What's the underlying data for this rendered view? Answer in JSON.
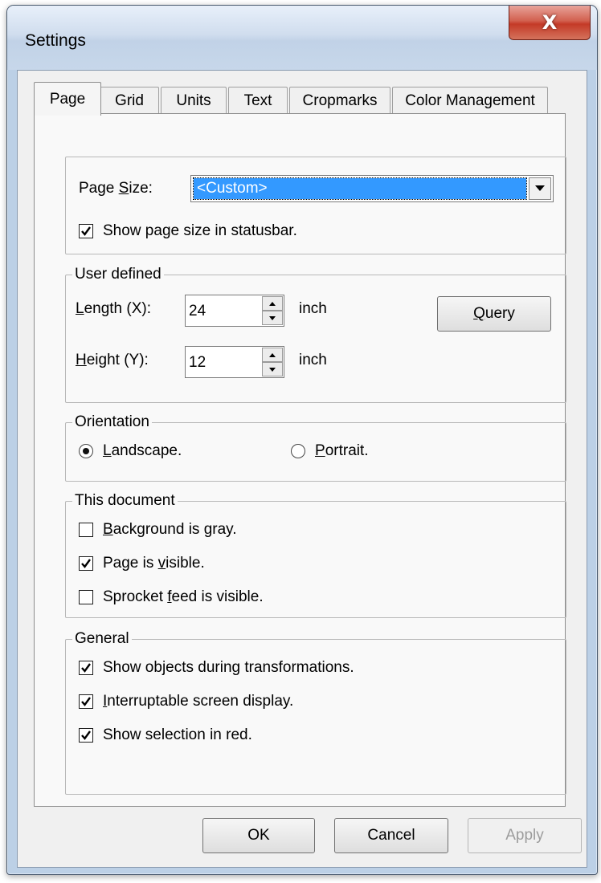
{
  "window": {
    "title": "Settings",
    "close_glyph": "X"
  },
  "tabs": [
    {
      "label": "Page"
    },
    {
      "label": "Grid"
    },
    {
      "label": "Units"
    },
    {
      "label": "Text"
    },
    {
      "label": "Cropmarks"
    },
    {
      "label": "Color Management"
    }
  ],
  "page_size": {
    "label": "Page Size:",
    "value": "<Custom>",
    "show_in_statusbar": {
      "label": "Show page size in statusbar.",
      "checked": true
    }
  },
  "user_defined": {
    "title": "User defined",
    "length": {
      "label": "Length  (X):",
      "value": "24",
      "unit": "inch"
    },
    "height": {
      "label": "Height (Y):",
      "value": "12",
      "unit": "inch"
    },
    "query_button": "Query"
  },
  "orientation": {
    "title": "Orientation",
    "landscape": {
      "label": "Landscape.",
      "selected": true
    },
    "portrait": {
      "label": "Portrait.",
      "selected": false
    }
  },
  "this_document": {
    "title": "This document",
    "options": [
      {
        "label": "Background is gray.",
        "checked": false
      },
      {
        "label": "Page is visible.",
        "checked": true
      },
      {
        "label": "Sprocket feed is visible.",
        "checked": false
      }
    ]
  },
  "general": {
    "title": "General",
    "options": [
      {
        "label": "Show objects during transformations.",
        "checked": true
      },
      {
        "label": "Interruptable screen display.",
        "checked": true
      },
      {
        "label": "Show selection in red.",
        "checked": true
      }
    ]
  },
  "buttons": {
    "ok": "OK",
    "cancel": "Cancel",
    "apply": "Apply"
  },
  "colors": {
    "selection": "#3399ff",
    "close_button": "#c43a27",
    "frame": "#bcd0e6"
  }
}
